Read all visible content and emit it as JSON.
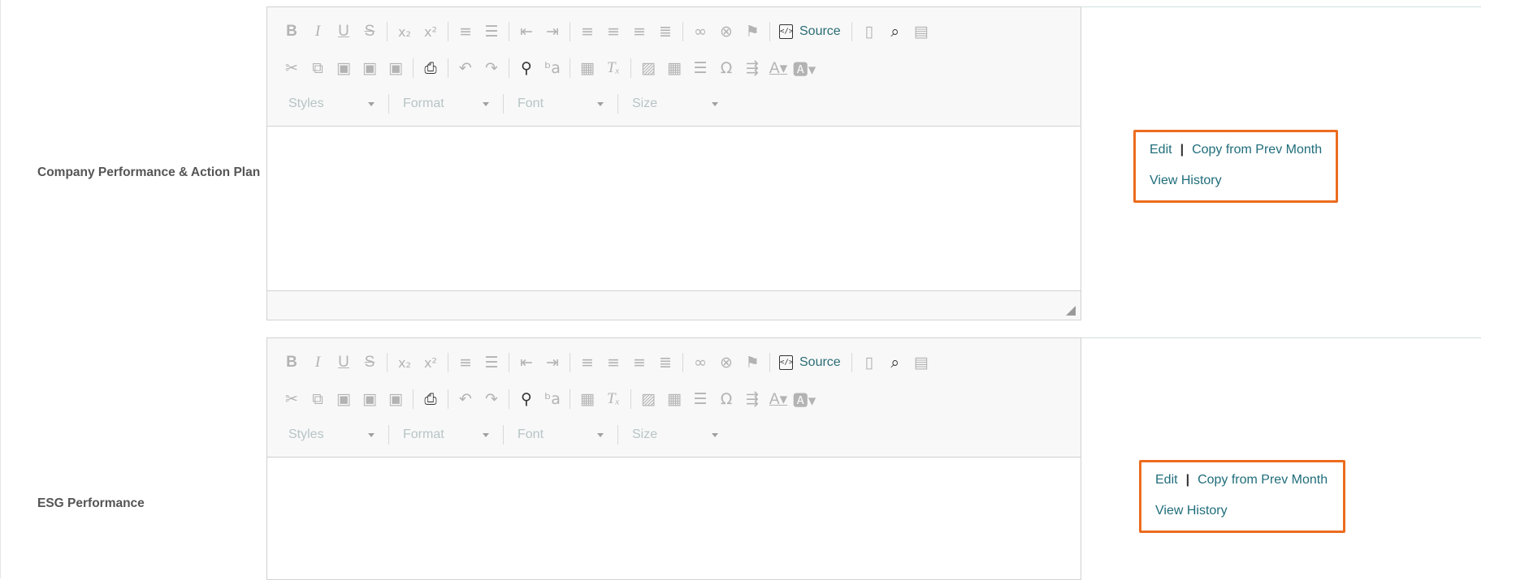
{
  "fields": [
    {
      "label": "Company Performance & Action Plan",
      "actions": {
        "edit": "Edit",
        "separator": "|",
        "copy": "Copy from Prev Month",
        "history": "View History"
      }
    },
    {
      "label": "ESG Performance",
      "actions": {
        "edit": "Edit",
        "separator": "|",
        "copy": "Copy from Prev Month",
        "history": "View History"
      }
    }
  ],
  "toolbar": {
    "source_label": "Source",
    "combos": {
      "styles": "Styles",
      "format": "Format",
      "font": "Font",
      "size": "Size"
    }
  },
  "colors": {
    "highlight": "#ec6c1e",
    "link": "#1f6d7a",
    "label": "#555555"
  }
}
